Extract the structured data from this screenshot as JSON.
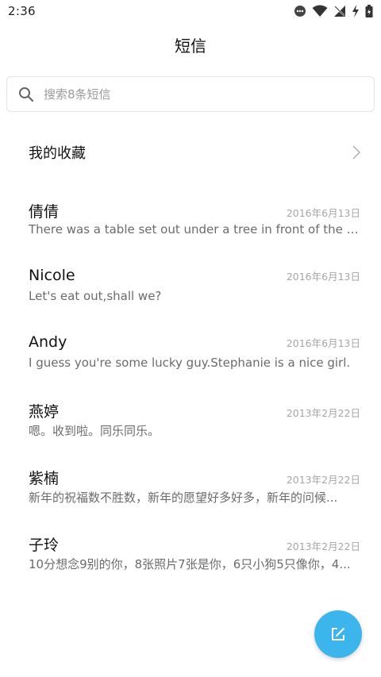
{
  "status_bar": {
    "time": "2:36",
    "icons": [
      "notification-dot-icon",
      "wifi-icon",
      "no-signal-icon",
      "charging-icon",
      "battery-icon"
    ]
  },
  "header": {
    "title": "短信"
  },
  "search": {
    "placeholder": "搜索8条短信",
    "icon": "search-icon"
  },
  "favorites": {
    "label": "我的收藏",
    "icon": "chevron-right-icon"
  },
  "messages": [
    {
      "name": "倩倩",
      "date": "2016年6月13日",
      "preview": "There was a table set out under a tree in front of the ho..."
    },
    {
      "name": "Nicole",
      "date": "2016年6月13日",
      "preview": "Let's eat out,shall we?"
    },
    {
      "name": "Andy",
      "date": "2016年6月13日",
      "preview": "I guess you're some lucky guy.Stephanie is a nice girl."
    },
    {
      "name": "燕婷",
      "date": "2013年2月22日",
      "preview": "嗯。收到啦。同乐同乐。"
    },
    {
      "name": "紫楠",
      "date": "2013年2月22日",
      "preview": "新年的祝福数不胜数，新年的愿望好多好多，新年的问候..."
    },
    {
      "name": "子玲",
      "date": "2013年2月22日",
      "preview": "10分想念9别的你，8张照片7张是你，6只小狗5只像你，4..."
    }
  ],
  "fab": {
    "icon": "compose-icon"
  },
  "colors": {
    "accent": "#3bb5ec",
    "text_primary": "#111111",
    "text_secondary": "#6b6b6b",
    "date": "#a6a6a6"
  }
}
